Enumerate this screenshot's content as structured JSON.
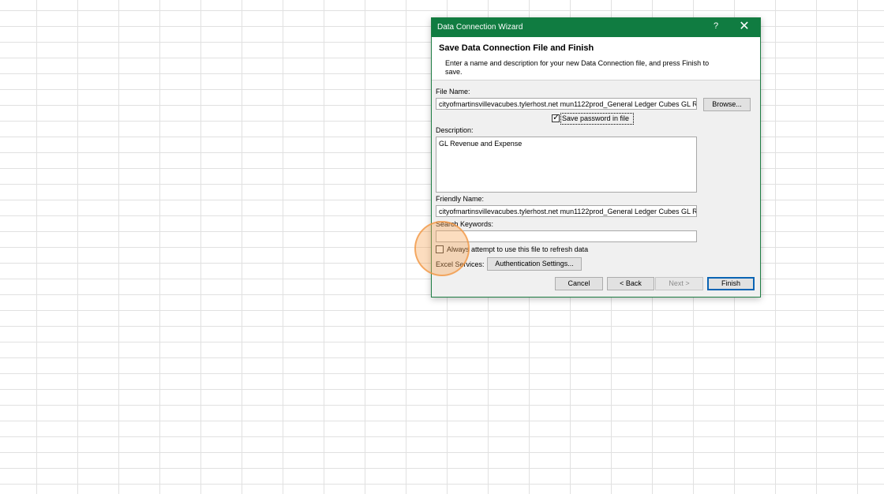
{
  "dialog": {
    "title": "Data Connection Wizard",
    "help": "?",
    "close": "✕",
    "header_title": "Save Data Connection File and Finish",
    "header_desc": "Enter a name and description for your new Data Connection file, and press Finish to save."
  },
  "form": {
    "file_name_label": "File Name:",
    "file_name_value": "cityofmartinsvillevacubes.tylerhost.net mun1122prod_General Ledger Cubes GL Revenue and Expense.odc",
    "browse_label": "Browse...",
    "save_password_label": "Save password in file",
    "save_password_checked": true,
    "description_label": "Description:",
    "description_value": "GL Revenue and Expense",
    "friendly_name_label": "Friendly Name:",
    "friendly_name_value": "cityofmartinsvillevacubes.tylerhost.net mun1122prod_General Ledger Cubes GL Revenue and Expense",
    "search_keywords_label": "Search Keywords:",
    "search_keywords_value": "",
    "always_attempt_label": "Always attempt to use this file to refresh data",
    "always_attempt_checked": false,
    "excel_services_label": "Excel Services:",
    "auth_settings_label": "Authentication Settings..."
  },
  "buttons": {
    "cancel": "Cancel",
    "back": "< Back",
    "next": "Next >",
    "finish": "Finish"
  },
  "colors": {
    "titlebar": "#107c41",
    "highlight": "#f6a658"
  }
}
